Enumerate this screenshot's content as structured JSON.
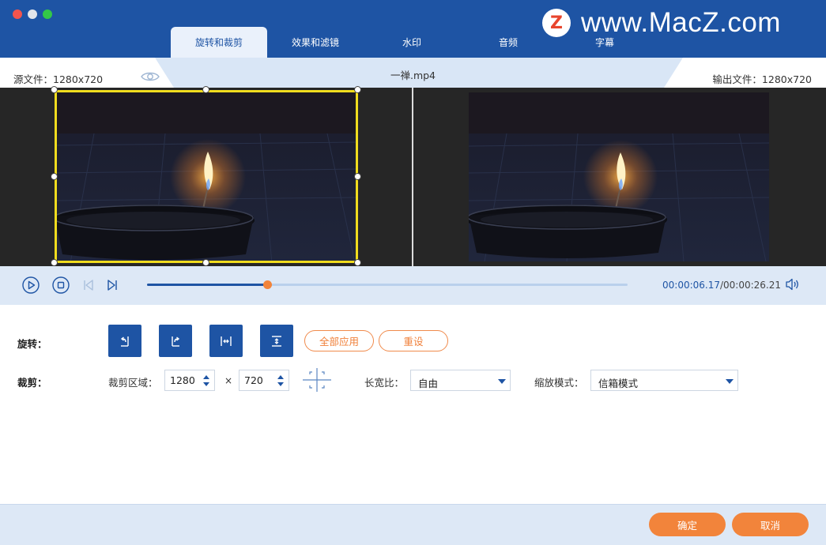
{
  "window": {
    "tabs": [
      {
        "label": "旋转和裁剪",
        "active": true
      },
      {
        "label": "效果和滤镜",
        "active": false
      },
      {
        "label": "水印",
        "active": false
      },
      {
        "label": "音频",
        "active": false
      },
      {
        "label": "字幕",
        "active": false
      }
    ],
    "watermark": {
      "logo_letter": "Z",
      "text": "www.MacZ.com"
    }
  },
  "info": {
    "source_label": "源文件：1280x720",
    "filename": "一禅.mp4",
    "output_label": "输出文件：1280x720"
  },
  "playback": {
    "current_time": "00:00:06.17",
    "total_time": "/00:00:26.21",
    "progress": 0.25
  },
  "rotate": {
    "label": "旋转：",
    "apply_all": "全部应用",
    "reset": "重设"
  },
  "crop": {
    "label": "裁剪：",
    "area_label": "裁剪区域：",
    "width": "1280",
    "times": "×",
    "height": "720",
    "aspect_label": "长宽比：",
    "aspect_value": "自由",
    "zoom_label": "缩放模式：",
    "zoom_value": "信箱模式"
  },
  "footer": {
    "confirm": "确定",
    "cancel": "取消"
  },
  "colors": {
    "brand_blue": "#1e54a4",
    "accent_orange": "#f2843b",
    "crop_yellow": "#f0dc1e"
  }
}
